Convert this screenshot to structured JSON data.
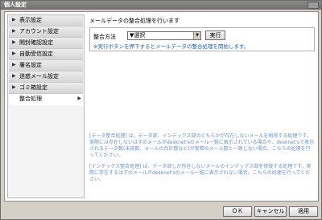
{
  "window": {
    "title": "個人設定"
  },
  "sidebar": {
    "items": [
      {
        "label": "表示設定",
        "active": false
      },
      {
        "label": "アカウント設定",
        "active": false
      },
      {
        "label": "開封確認設定",
        "active": false
      },
      {
        "label": "自動受信設定",
        "active": false
      },
      {
        "label": "署名設定",
        "active": false
      },
      {
        "label": "迷惑メール設定",
        "active": false
      },
      {
        "label": "ゴミ箱設定",
        "active": false
      },
      {
        "label": "整合処理",
        "active": true
      }
    ]
  },
  "main": {
    "heading": "メールデータの整合処理を行います",
    "field_label": "整合方法",
    "select_value": "▼選択",
    "run_button": "実行",
    "hint": "※実行ボタンを押下するとメールデータの整合処理を開始します。",
    "notes": [
      "[データ整合処理] は、データ部、インデックス部のどちらかが存在しないメールを削除する処理です。実際には存在しないはずのメールがdesknet'sのメール一覧に表示されている場合や、desknet'sで表示されるデータ数(未読数、メールの合計数など)が実際のメール数と一致しない場合、こちらの処理を行ってください。",
      "[インデックス整合処理] は、データ部しか存在しないメールのインデックス部を修復する処理です。実際に存在するはずのメールがdesknet'sのメール一覧に表示されない場合、こちらの処理を行ってください。"
    ]
  },
  "footer": {
    "ok": "ＯＫ",
    "cancel": "キャンセル",
    "apply": "適用"
  },
  "colors": {
    "hint_text": "#1e5fb8",
    "notes_text": "#6a8fc8",
    "window_bg": "#d4d0c8"
  }
}
